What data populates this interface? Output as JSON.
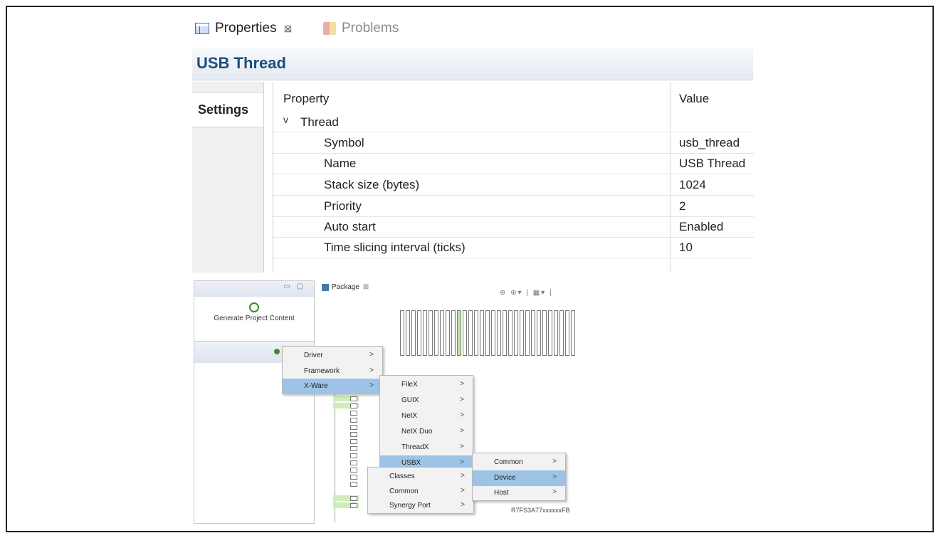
{
  "tabs": [
    {
      "label": "Properties",
      "close": "⊠"
    },
    {
      "label": "Problems"
    }
  ],
  "header": {
    "title": "USB Thread"
  },
  "sidebar": {
    "tab": "Settings"
  },
  "table": {
    "col_property": "Property",
    "col_value": "Value",
    "group": {
      "label": "Thread",
      "chevron": "v"
    },
    "rows": [
      {
        "name": "Symbol",
        "value": "usb_thread"
      },
      {
        "name": "Name",
        "value": "USB Thread"
      },
      {
        "name": "Stack size (bytes)",
        "value": "1024"
      },
      {
        "name": "Priority",
        "value": "2"
      },
      {
        "name": "Auto start",
        "value": "Enabled"
      },
      {
        "name": "Time slicing interval (ticks)",
        "value": "10"
      }
    ]
  },
  "configurator": {
    "generate_label": "Generate Project Content",
    "package_tab": "Package",
    "chip_label": "R7FS3A77xxxxxxFB",
    "menu1": [
      {
        "label": "Driver",
        "arrow": ">"
      },
      {
        "label": "Framework",
        "arrow": ">"
      },
      {
        "label": "X-Ware",
        "arrow": ">"
      }
    ],
    "menu2": [
      {
        "label": "FileX",
        "arrow": ">"
      },
      {
        "label": "GUIX",
        "arrow": ">"
      },
      {
        "label": "NetX",
        "arrow": ">"
      },
      {
        "label": "NetX Duo",
        "arrow": ">"
      },
      {
        "label": "ThreadX",
        "arrow": ">"
      },
      {
        "label": "USBX",
        "arrow": ">"
      }
    ],
    "menu3": [
      {
        "label": "Classes",
        "arrow": ">"
      },
      {
        "label": "Common",
        "arrow": ">"
      },
      {
        "label": "Synergy Port",
        "arrow": ">"
      }
    ],
    "menu4": [
      {
        "label": "Common",
        "arrow": ">"
      },
      {
        "label": "Device",
        "arrow": ">"
      },
      {
        "label": "Host",
        "arrow": ">"
      }
    ]
  }
}
